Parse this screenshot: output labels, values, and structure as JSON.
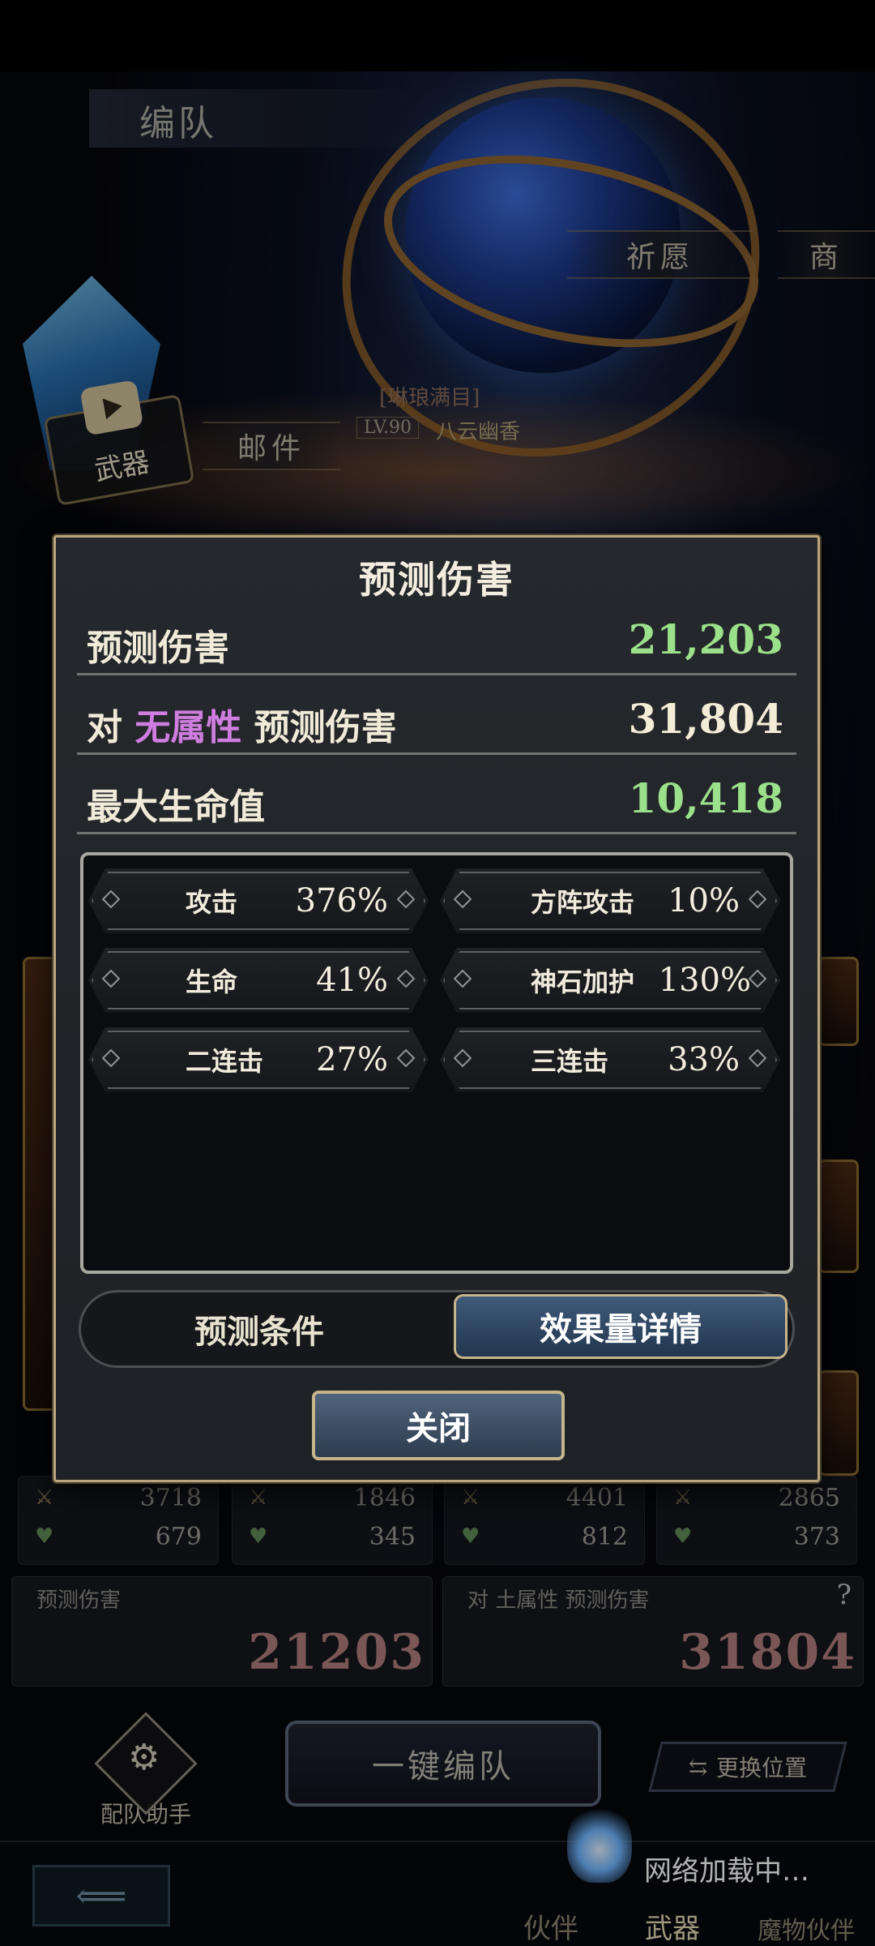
{
  "page": {
    "title": "编队"
  },
  "scene": {
    "nav_pray": "祈愿",
    "nav_shop": "商",
    "nav_mail": "邮件",
    "weapon_badge": "武器",
    "character": {
      "title": "[琳琅满目]",
      "level": "LV.90",
      "name": "八云幽香"
    }
  },
  "cards": [
    {
      "atk": "3718",
      "hp": "679"
    },
    {
      "atk": "1846",
      "hp": "345"
    },
    {
      "atk": "4401",
      "hp": "812"
    },
    {
      "atk": "2865",
      "hp": "373"
    }
  ],
  "damage_panels": {
    "left_label": "预测伤害",
    "left_value": "21203",
    "right_label": "对 土属性  预测伤害",
    "right_value": "31804",
    "help": "?"
  },
  "bottom": {
    "helper_label": "配队助手",
    "auto_button": "一键编队",
    "swap_button": "更换位置",
    "tabs": [
      "伙伴",
      "武器",
      "魔物伙伴"
    ],
    "loading": "网络加载中…"
  },
  "modal": {
    "title": "预测伤害",
    "rows": [
      {
        "label": "预测伤害",
        "value": "21,203"
      },
      {
        "label_prefix": "对",
        "label_accent": "无属性",
        "label_suffix": "预测伤害",
        "value": "31,804"
      },
      {
        "label": "最大生命值",
        "value": "10,418"
      }
    ],
    "stats": [
      {
        "label": "攻击",
        "value": "376%"
      },
      {
        "label": "方阵攻击",
        "value": "10%"
      },
      {
        "label": "生命",
        "value": "41%"
      },
      {
        "label": "神石加护",
        "value": "130%"
      },
      {
        "label": "二连击",
        "value": "27%"
      },
      {
        "label": "三连击",
        "value": "33%"
      }
    ],
    "tab_conditions": "预测条件",
    "tab_details": "效果量详情",
    "close": "关闭"
  },
  "colors": {
    "green": "#9be08a",
    "accent_purple": "#cf7ee0",
    "gold_border": "#b9a67c"
  }
}
